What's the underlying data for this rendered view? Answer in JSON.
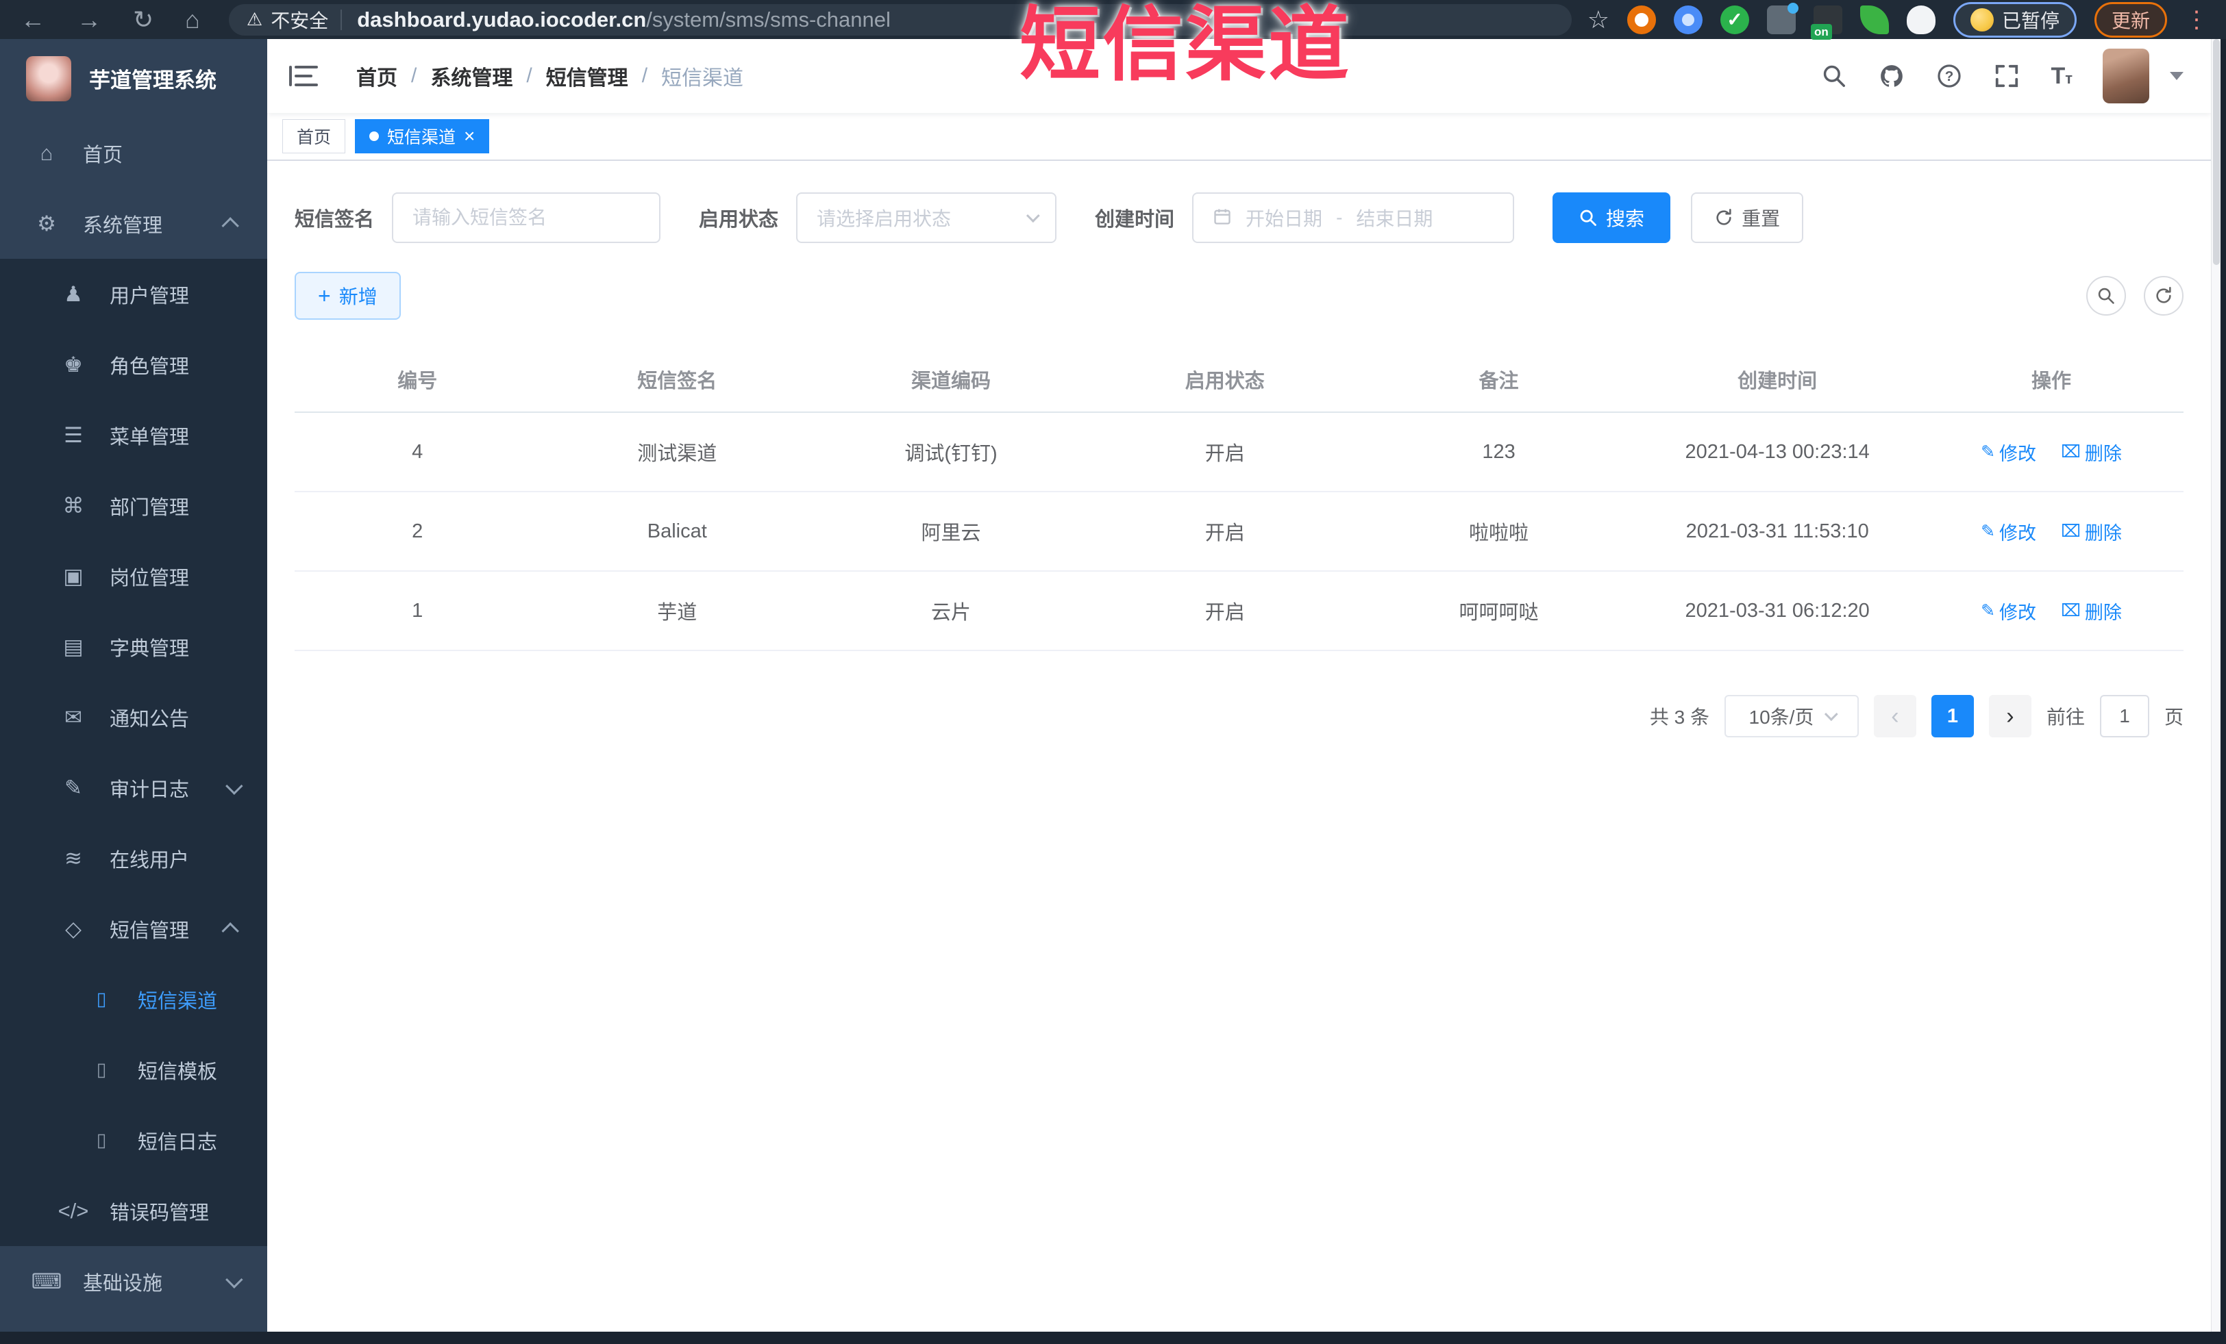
{
  "colors": {
    "primary": "#1989fa",
    "sidebar_bg": "#1f2d3d",
    "sidebar_light": "#304156",
    "sidebar_text": "#bfcbd9",
    "active_text": "#3e9eff",
    "watermark_red": "#f83b5c",
    "browser_bar": "#202b37"
  },
  "browser": {
    "back": "←",
    "forward": "→",
    "reload": "↻",
    "home": "⌂",
    "warning_glyph": "⚠",
    "not_secure": "不安全",
    "url_domain": "dashboard.yudao.iocoder.cn",
    "url_path": "/system/sms/sms-channel",
    "star": "☆",
    "on_badge": "on",
    "paused_label": "已暂停",
    "update_label": "更新",
    "menu_dots": "⋮"
  },
  "watermark": "短信渠道",
  "sidebar": {
    "title": "芋道管理系统",
    "items": [
      {
        "label": "首页",
        "glyph": "⌂"
      },
      {
        "label": "系统管理",
        "glyph": "⚙"
      },
      {
        "label": "用户管理",
        "glyph": "♟"
      },
      {
        "label": "角色管理",
        "glyph": "♚"
      },
      {
        "label": "菜单管理",
        "glyph": "☰"
      },
      {
        "label": "部门管理",
        "glyph": "⌘"
      },
      {
        "label": "岗位管理",
        "glyph": "▣"
      },
      {
        "label": "字典管理",
        "glyph": "▤"
      },
      {
        "label": "通知公告",
        "glyph": "✉"
      },
      {
        "label": "审计日志",
        "glyph": "✎"
      },
      {
        "label": "在线用户",
        "glyph": "≋"
      },
      {
        "label": "短信管理",
        "glyph": "◇"
      },
      {
        "label": "短信渠道",
        "glyph": "▯"
      },
      {
        "label": "短信模板",
        "glyph": "▯"
      },
      {
        "label": "短信日志",
        "glyph": "▯"
      },
      {
        "label": "错误码管理",
        "glyph": "</>"
      },
      {
        "label": "基础设施",
        "glyph": "⌨"
      }
    ]
  },
  "navbar": {
    "breadcrumb": [
      "首页",
      "系统管理",
      "短信管理",
      "短信渠道"
    ],
    "separator": "/"
  },
  "tags": {
    "items": [
      {
        "label": "首页"
      },
      {
        "label": "短信渠道",
        "close": "×"
      }
    ]
  },
  "filter": {
    "signature_label": "短信签名",
    "signature_placeholder": "请输入短信签名",
    "status_label": "启用状态",
    "status_placeholder": "请选择启用状态",
    "time_label": "创建时间",
    "start_placeholder": "开始日期",
    "range_separator": "-",
    "end_placeholder": "结束日期",
    "search_label": "搜索",
    "reset_label": "重置"
  },
  "toolbar": {
    "plus": "+",
    "add_label": "新增"
  },
  "table": {
    "headers": [
      "编号",
      "短信签名",
      "渠道编码",
      "启用状态",
      "备注",
      "创建时间",
      "操作"
    ],
    "edit_glyph": "✎",
    "edit_label": "修改",
    "delete_glyph": "⌧",
    "delete_label": "删除",
    "rows": [
      {
        "id": "4",
        "signature": "测试渠道",
        "code": "调试(钉钉)",
        "status": "开启",
        "remark": "123",
        "created": "2021-04-13 00:23:14"
      },
      {
        "id": "2",
        "signature": "Balicat",
        "code": "阿里云",
        "status": "开启",
        "remark": "啦啦啦",
        "created": "2021-03-31 11:53:10"
      },
      {
        "id": "1",
        "signature": "芋道",
        "code": "云片",
        "status": "开启",
        "remark": "呵呵呵哒",
        "created": "2021-03-31 06:12:20"
      }
    ]
  },
  "pagination": {
    "total": "共 3 条",
    "page_size": "10条/页",
    "prev": "‹",
    "current": "1",
    "next": "›",
    "goto_label": "前往",
    "page_value": "1",
    "page_unit": "页"
  }
}
